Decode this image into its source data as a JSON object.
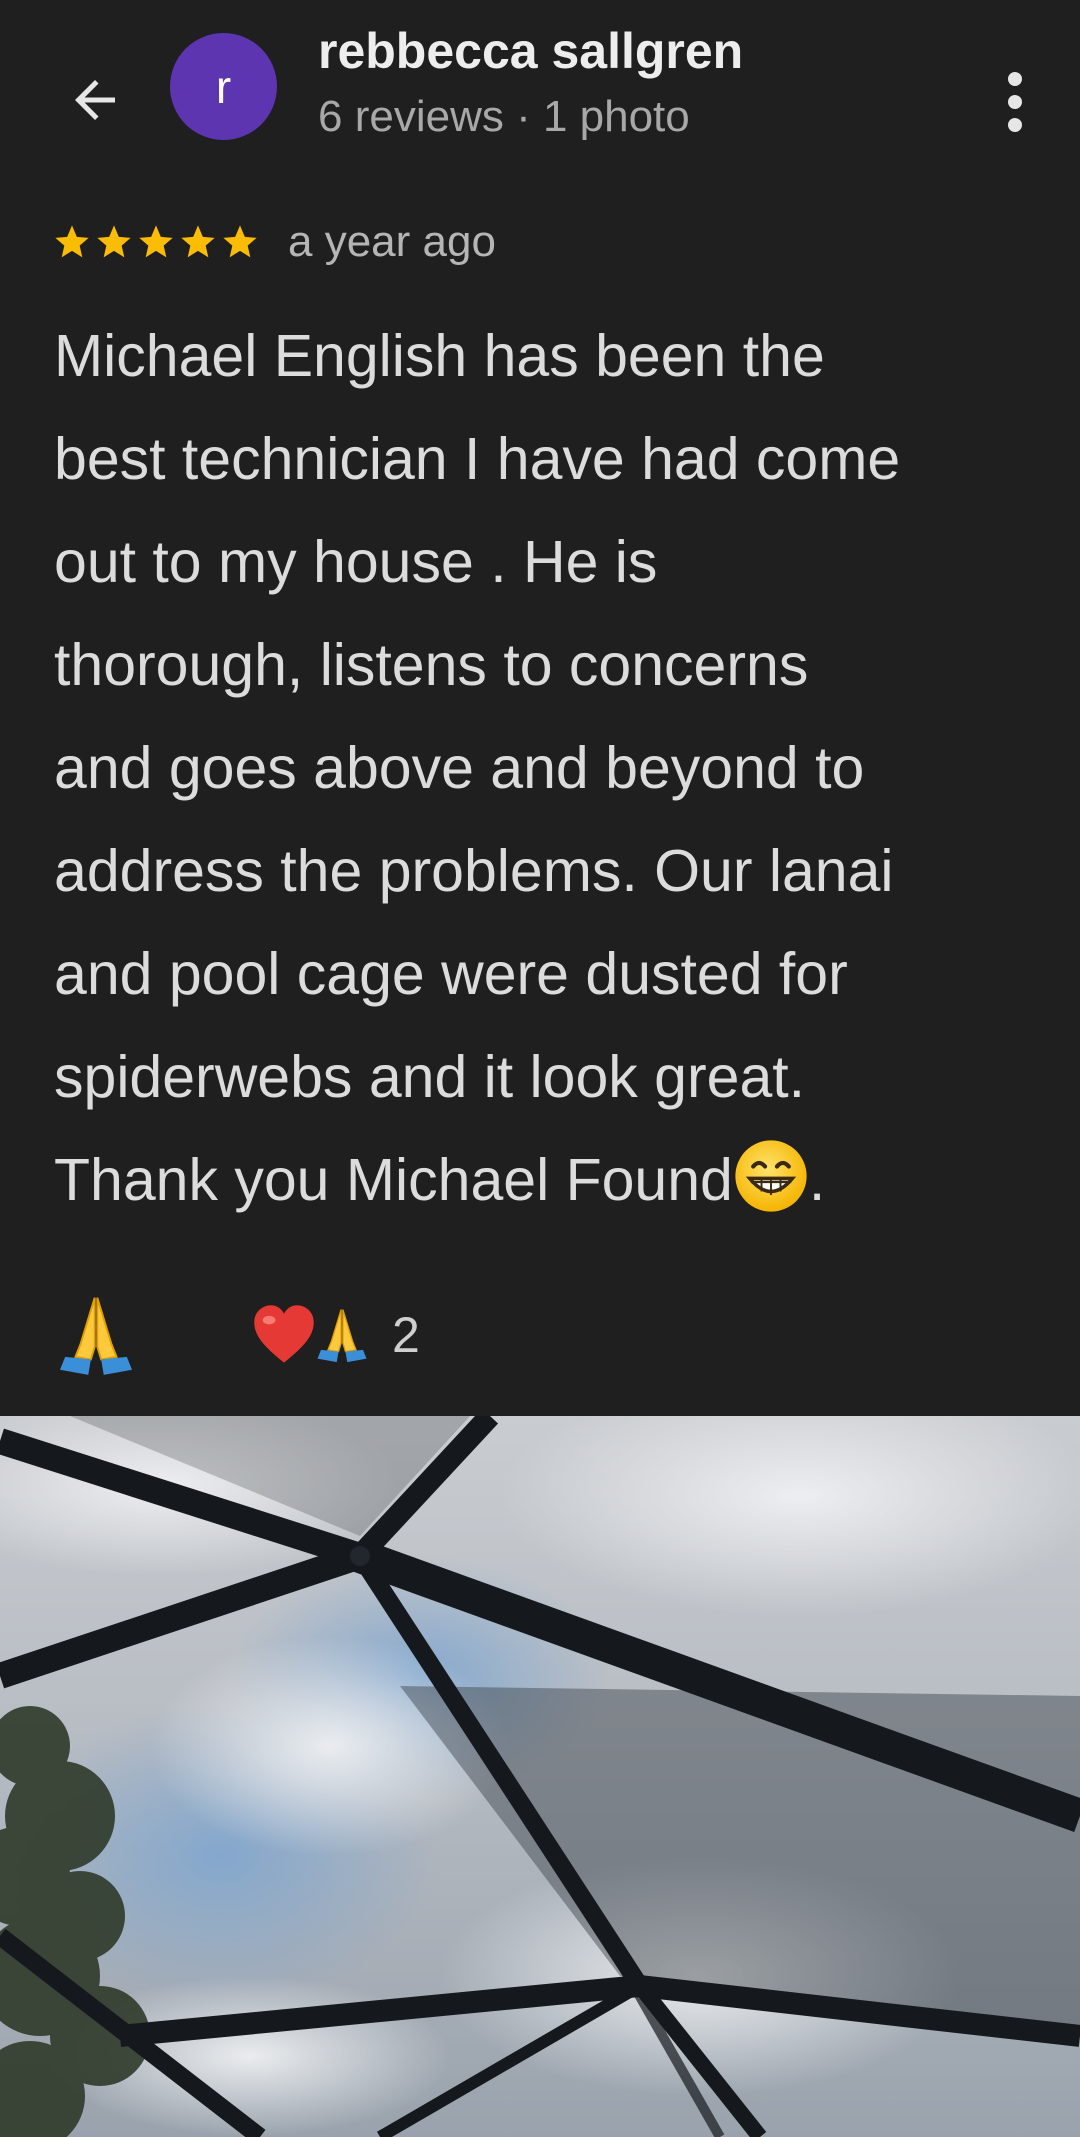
{
  "header": {
    "avatar_letter": "r",
    "reviewer_name": "rebbecca sallgren",
    "reviewer_stats": "6 reviews · 1 photo",
    "back_icon": "arrow-back-icon",
    "more_icon": "more-vert-icon"
  },
  "review": {
    "rating": 5,
    "max_rating": 5,
    "date": "a year ago",
    "lines": [
      "Michael English has been the",
      "best technician I have had come",
      "out to my house . He is",
      "thorough, listens to concerns",
      "and goes above and beyond to",
      "address the problems. Our lanai",
      "and pool cage were dusted for",
      "spiderwebs and it look great.",
      "Thank you Michael Found"
    ],
    "trailing_punct": "."
  },
  "reactions": {
    "primary_icon": "folded-hands-icon",
    "summary_icons": [
      "red-heart-icon",
      "folded-hands-icon"
    ],
    "count": "2"
  },
  "photo": {
    "icon": "pool-cage-photo"
  },
  "colors": {
    "background": "#1f1f1f",
    "avatar": "#5e35b1",
    "star": "#fbbc04",
    "text_primary": "#e3e3e3",
    "text_secondary": "#a8a8a8"
  }
}
